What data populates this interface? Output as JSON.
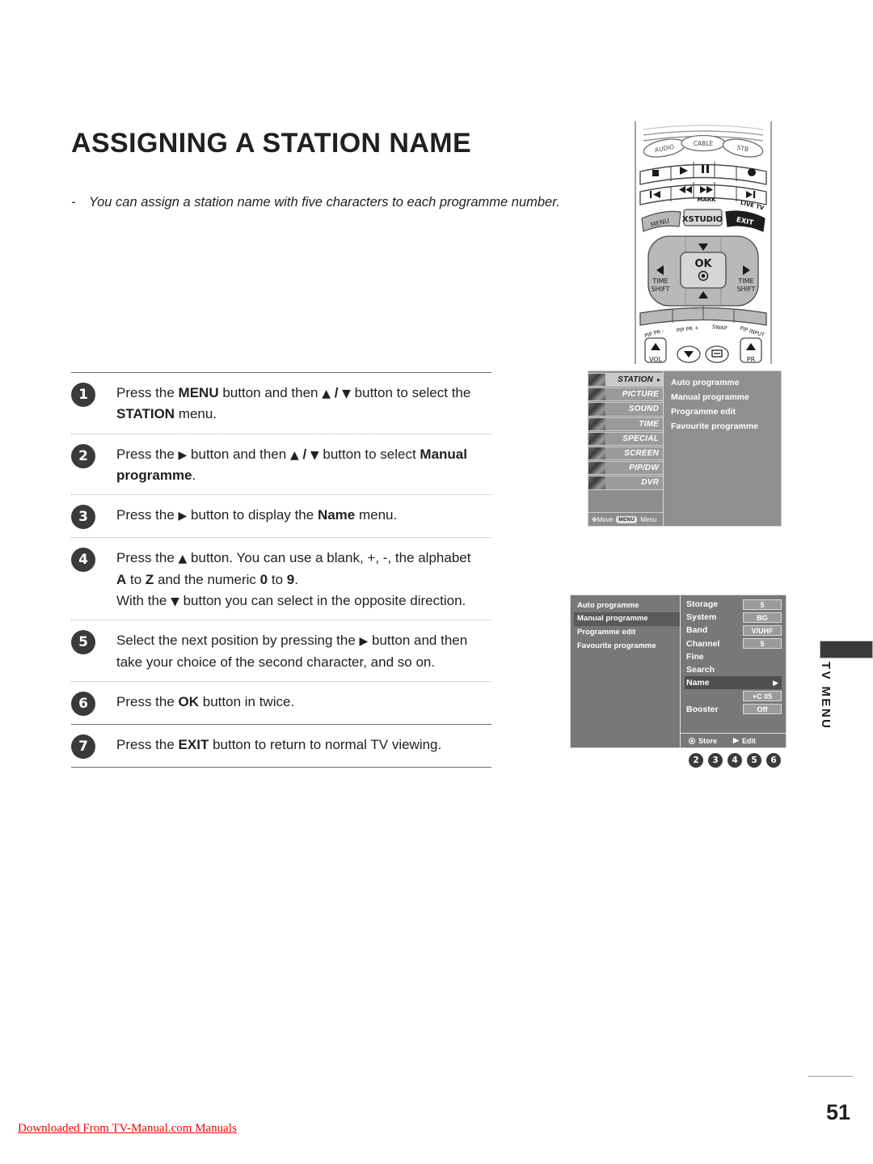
{
  "page": {
    "title": "ASSIGNING A STATION NAME",
    "intro_dash": "-",
    "intro": "You can assign a station name with five characters to each programme number.",
    "page_number": "51",
    "download_link": "Downloaded From TV-Manual.com Manuals"
  },
  "steps": [
    {
      "number": "1",
      "lines": [
        [
          {
            "t": "Press the ",
            "b": false
          },
          {
            "t": "MENU",
            "b": true
          },
          {
            "t": " button and then ",
            "b": false
          },
          {
            "t": "▲",
            "b": true
          },
          {
            "t": " / ",
            "b": true
          },
          {
            "t": "▼",
            "b": true
          },
          {
            "t": " button to select the",
            "b": false
          }
        ],
        [
          {
            "t": "STATION",
            "b": true
          },
          {
            "t": " menu.",
            "b": false
          }
        ]
      ]
    },
    {
      "number": "2",
      "lines": [
        [
          {
            "t": "Press the ",
            "b": false
          },
          {
            "t": "▶",
            "b": true
          },
          {
            "t": " button and then ",
            "b": false
          },
          {
            "t": "▲",
            "b": true
          },
          {
            "t": " / ",
            "b": true
          },
          {
            "t": "▼",
            "b": true
          },
          {
            "t": " button to select ",
            "b": false
          },
          {
            "t": "Manual",
            "b": true
          }
        ],
        [
          {
            "t": "programme",
            "b": true
          },
          {
            "t": ".",
            "b": false
          }
        ]
      ]
    },
    {
      "number": "3",
      "lines": [
        [
          {
            "t": "Press the ",
            "b": false
          },
          {
            "t": "▶",
            "b": true
          },
          {
            "t": " button to display the ",
            "b": false
          },
          {
            "t": "Name",
            "b": true
          },
          {
            "t": " menu.",
            "b": false
          }
        ]
      ]
    },
    {
      "number": "4",
      "lines": [
        [
          {
            "t": "Press the ",
            "b": false
          },
          {
            "t": "▲",
            "b": true
          },
          {
            "t": " button. You can use a blank, +, -, the alphabet",
            "b": false
          }
        ],
        [
          {
            "t": "A",
            "b": true
          },
          {
            "t": " to ",
            "b": false
          },
          {
            "t": "Z",
            "b": true
          },
          {
            "t": " and the numeric ",
            "b": false
          },
          {
            "t": "0",
            "b": true
          },
          {
            "t": " to ",
            "b": false
          },
          {
            "t": "9",
            "b": true
          },
          {
            "t": ".",
            "b": false
          }
        ],
        [
          {
            "t": "With the ",
            "b": false
          },
          {
            "t": "▼",
            "b": true
          },
          {
            "t": " button you can select in the opposite direction.",
            "b": false
          }
        ]
      ]
    },
    {
      "number": "5",
      "lines": [
        [
          {
            "t": "Select the next position by pressing the ",
            "b": false
          },
          {
            "t": "▶",
            "b": true
          },
          {
            "t": " button and then",
            "b": false
          }
        ],
        [
          {
            "t": "take your choice of the second character, and so on.",
            "b": false
          }
        ]
      ]
    },
    {
      "number": "6",
      "lines": [
        [
          {
            "t": "Press the ",
            "b": false
          },
          {
            "t": "OK",
            "b": true
          },
          {
            "t": " button in twice.",
            "b": false
          }
        ]
      ]
    },
    {
      "number": "7",
      "lines": [
        [
          {
            "t": "Press the ",
            "b": false
          },
          {
            "t": "EXIT",
            "b": true
          },
          {
            "t": " button to return to normal TV viewing.",
            "b": false
          }
        ]
      ]
    }
  ],
  "remote": {
    "source_buttons": [
      "AUDIO",
      "CABLE",
      "STB"
    ],
    "transport_row1": [
      "stop-icon",
      "play-icon",
      "pause-icon",
      "record-icon"
    ],
    "transport_row2": [
      "skip-back-icon",
      "rewind-icon",
      "fast-forward-icon",
      "skip-forward-icon"
    ],
    "transport_labels": [
      "MARK",
      "LIVE TV"
    ],
    "menu_row": [
      "MENU",
      "XSTUDIO",
      "EXIT"
    ],
    "navigation": {
      "ok": "OK",
      "left_label": "TIME SHIFT",
      "right_label": "TIME SHIFT",
      "up": "up-arrow-icon",
      "down": "down-arrow-icon"
    },
    "pip_row": [
      "PIP PR -",
      "PIP PR +",
      "SWAP",
      "PIP INPUT"
    ],
    "bottom_row": [
      "VOL",
      "PR"
    ]
  },
  "osd_station_menu": {
    "marker": "1",
    "sidebar": [
      {
        "label": "STATION",
        "selected": true,
        "caret": "▸"
      },
      {
        "label": "PICTURE",
        "selected": false
      },
      {
        "label": "SOUND",
        "selected": false
      },
      {
        "label": "TIME",
        "selected": false
      },
      {
        "label": "SPECIAL",
        "selected": false
      },
      {
        "label": "SCREEN",
        "selected": false
      },
      {
        "label": "PIP/DW",
        "selected": false
      },
      {
        "label": "DVR",
        "selected": false
      }
    ],
    "footer": {
      "move_label": "Move",
      "menu_key": "MENU",
      "menu_label": "Menu"
    },
    "items": [
      "Auto programme",
      "Manual programme",
      "Programme edit",
      "Favourite programme"
    ]
  },
  "osd_manual_menu": {
    "markers": [
      "2",
      "3",
      "4",
      "5",
      "6"
    ],
    "left_items": [
      {
        "label": "Auto programme",
        "selected": false
      },
      {
        "label": "Manual programme",
        "selected": true
      },
      {
        "label": "Programme edit",
        "selected": false
      },
      {
        "label": "Favourite programme",
        "selected": false
      }
    ],
    "rows": [
      {
        "label": "Storage",
        "value": "5",
        "type": "value",
        "selected": false
      },
      {
        "label": "System",
        "value": "BG",
        "type": "value",
        "selected": false
      },
      {
        "label": "Band",
        "value": "V/UHF",
        "type": "value",
        "selected": false
      },
      {
        "label": "Channel",
        "value": "5",
        "type": "value",
        "selected": false
      },
      {
        "label": "Fine",
        "value": "",
        "type": "plain",
        "selected": false
      },
      {
        "label": "Search",
        "value": "",
        "type": "plain",
        "selected": false
      },
      {
        "label": "Name",
        "value": "▶",
        "type": "caret",
        "selected": true
      },
      {
        "label": "",
        "value": "+C 05",
        "type": "value",
        "selected": false
      },
      {
        "label": "Booster",
        "value": "Off",
        "type": "value",
        "selected": false
      }
    ],
    "footer": {
      "store_label": "Store",
      "edit_label": "Edit",
      "edit_glyph": "▶"
    }
  },
  "tv_menu_tab": {
    "label": "TV MENU"
  }
}
